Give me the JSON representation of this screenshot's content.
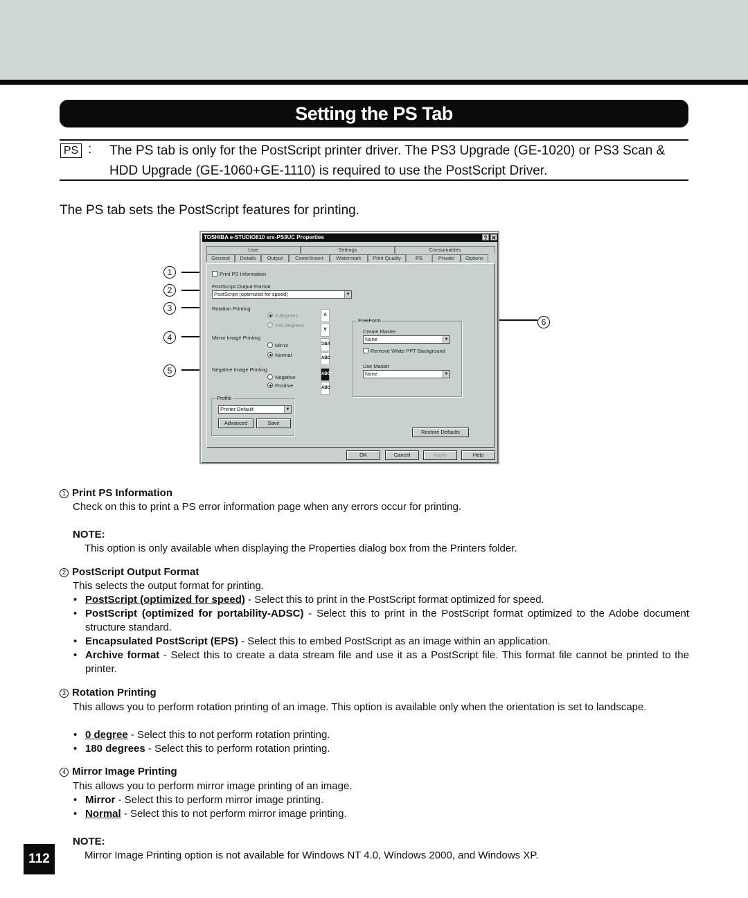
{
  "header": {
    "title": "Setting the PS Tab"
  },
  "intro": {
    "badge": "PS",
    "colon": ":",
    "text": "The PS tab is only for the PostScript printer driver.  The PS3 Upgrade (GE-1020) or PS3 Scan & HDD Upgrade (GE-1060+GE-1110) is required to use the PostScript Driver.",
    "lead": "The PS tab sets the PostScript features for printing."
  },
  "dialog": {
    "title": "TOSHIBA e-STUDIO810 srs-PS3UC Properties",
    "help_btn": "?",
    "close_btn": "✕",
    "tabs_row1": [
      "User",
      "Settings",
      "Consumables"
    ],
    "tabs_row2": [
      "General",
      "Details",
      "Output",
      "Cover/Insert",
      "Watermark",
      "Print Quality",
      "PS",
      "Private",
      "Options"
    ],
    "active_tab": "PS",
    "print_ps_info": {
      "label": "Print PS Information",
      "checked": false
    },
    "output_format": {
      "label": "PostScript Output Format",
      "value": "PostScript (optimized for speed)"
    },
    "rotation": {
      "label": "Rotation Printing",
      "options": [
        "0 degrees",
        "180 degrees"
      ],
      "selected": "0 degrees",
      "disabled": true
    },
    "mirror": {
      "label": "Mirror Image Printing",
      "options": [
        "Mirror",
        "Normal"
      ],
      "selected": "Normal"
    },
    "negative": {
      "label": "Negative Image Printing",
      "options": [
        "Negative",
        "Positive"
      ],
      "selected": "Positive"
    },
    "preview_icons": {
      "rot0": "A",
      "rot180": "∀",
      "mirror": "ƆBA",
      "normal": "ABC",
      "negative": "ABC",
      "positive": "ABC"
    },
    "freeform": {
      "label": "FreeForm",
      "create_master_label": "Create Master",
      "create_master_value": "None",
      "remove_white_label": "Remove White PPT Background",
      "remove_white_checked": false,
      "use_master_label": "Use Master",
      "use_master_value": "None"
    },
    "profile": {
      "label": "Profile",
      "value": "Printer Default",
      "advanced": "Advanced",
      "save": "Save"
    },
    "restore_defaults": "Restore Defaults",
    "buttons": {
      "ok": "OK",
      "cancel": "Cancel",
      "apply": "Apply",
      "help": "Help"
    },
    "callouts": [
      "1",
      "2",
      "3",
      "4",
      "5",
      "6"
    ]
  },
  "sections": {
    "s1": {
      "num": "1",
      "title": "Print PS Information",
      "text": "Check on this to print a PS error information page when any errors occur for printing.",
      "note_label": "NOTE:",
      "note": "This option is only available when displaying the Properties dialog box from the Printers folder."
    },
    "s2": {
      "num": "2",
      "title": "PostScript Output Format",
      "text": "This selects the output format for printing.",
      "bullets": [
        {
          "term": "PostScript (optimized for speed)",
          "desc": " - Select this to print in the PostScript format optimized for speed."
        },
        {
          "term": "PostScript (optimized for portability-ADSC)",
          "desc": " - Select this to print in the PostScript format optimized to the Adobe document structure standard."
        },
        {
          "term": "Encapsulated PostScript (EPS)",
          "desc": " - Select this to embed PostScript as an image within an application."
        },
        {
          "term": "Archive format",
          "desc": " - Select this to create a data stream file and use it as a PostScript file.  This format file cannot be printed to the printer."
        }
      ]
    },
    "s3": {
      "num": "3",
      "title": "Rotation Printing",
      "text": "This allows you to perform rotation printing of an image.  This option is available only when the orientation is set to landscape.",
      "bullets": [
        {
          "term": "0 degree",
          "desc": " - Select this to not perform rotation printing."
        },
        {
          "term": "180 degrees",
          "desc": " - Select this to perform rotation printing."
        }
      ]
    },
    "s4": {
      "num": "4",
      "title": "Mirror Image Printing",
      "text": "This allows you to perform mirror image printing of an image.",
      "bullets": [
        {
          "term": "Mirror",
          "desc": " - Select this to perform mirror image printing."
        },
        {
          "term": "Normal",
          "desc": " - Select this to not perform mirror image printing."
        }
      ],
      "note_label": "NOTE:",
      "note": "Mirror Image Printing option is not available for Windows NT 4.0, Windows 2000, and Windows XP."
    }
  },
  "page_number": "112"
}
